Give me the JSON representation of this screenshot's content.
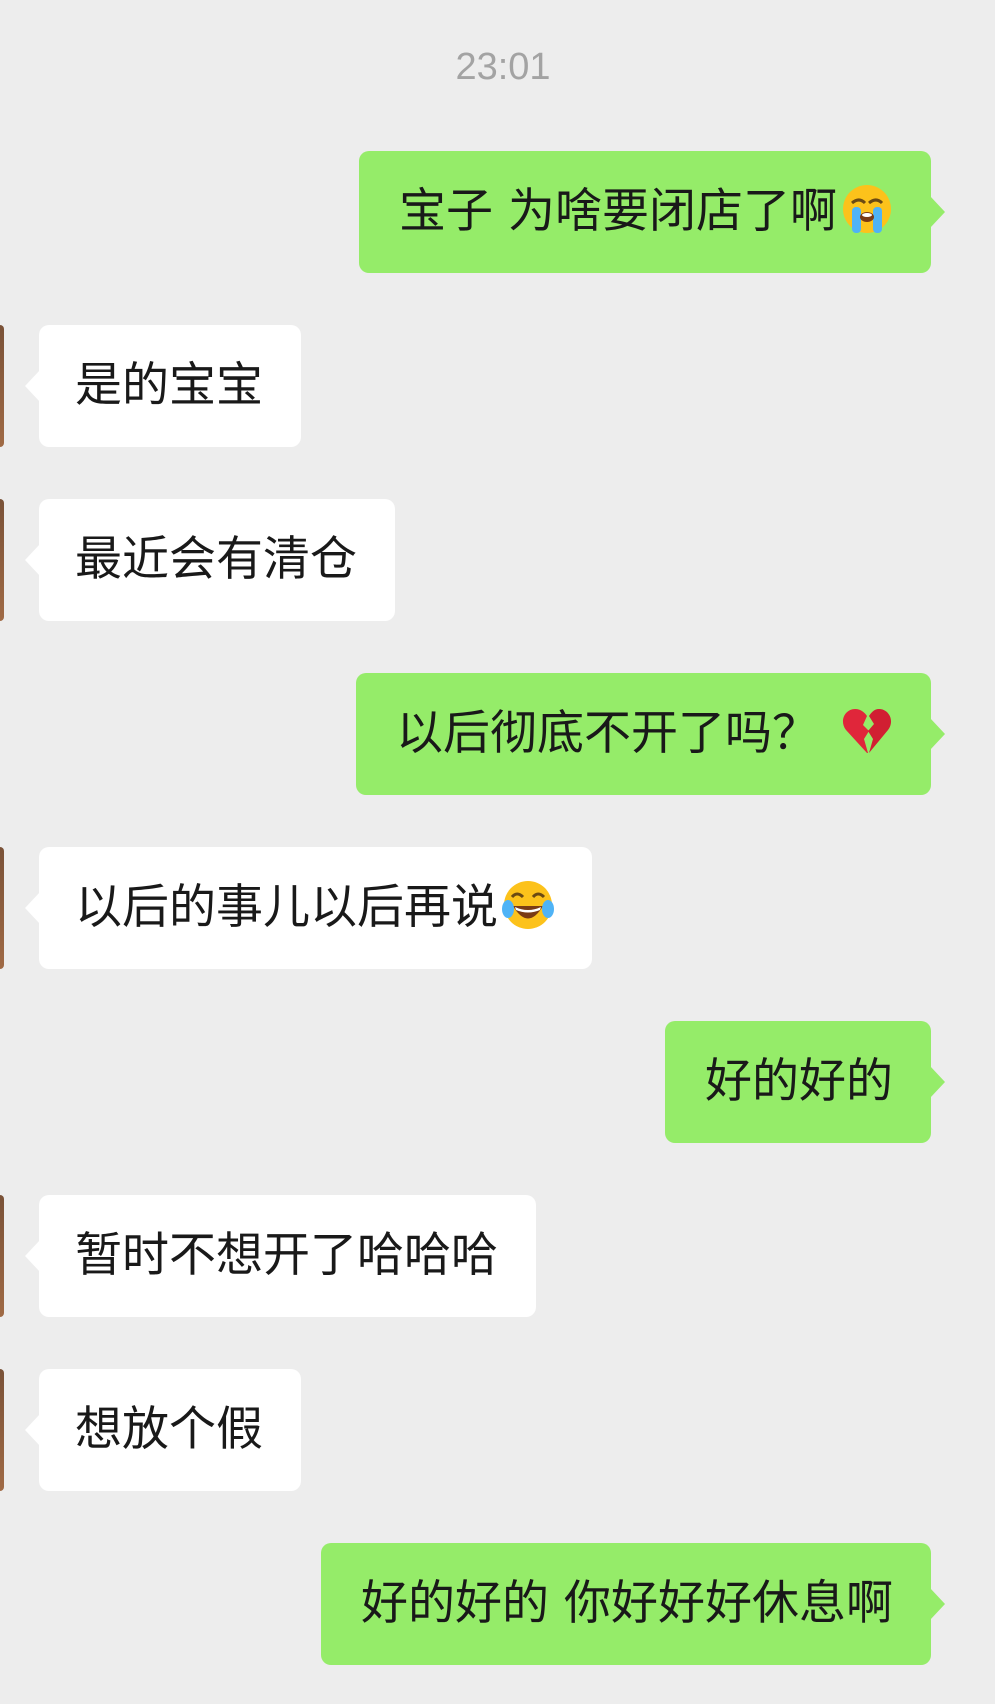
{
  "chat": {
    "timestamp": "23:01",
    "messages": [
      {
        "sender": "me",
        "text": "宝子 为啥要闭店了啊",
        "emoji": "loudly-crying-face-emoji"
      },
      {
        "sender": "them",
        "text": "是的宝宝"
      },
      {
        "sender": "them",
        "text": "最近会有清仓"
      },
      {
        "sender": "me",
        "text": "以后彻底不开了吗？",
        "emoji": "broken-heart-emoji"
      },
      {
        "sender": "them",
        "text": "以后的事儿以后再说",
        "emoji": "face-with-tears-of-joy-emoji"
      },
      {
        "sender": "me",
        "text": "好的好的"
      },
      {
        "sender": "them",
        "text": "暂时不想开了哈哈哈"
      },
      {
        "sender": "them",
        "text": "想放个假"
      },
      {
        "sender": "me",
        "text": "好的好的 你好好好休息啊"
      }
    ]
  },
  "colors": {
    "background": "#ededed",
    "sent_bubble": "#95ec69",
    "received_bubble": "#ffffff",
    "timestamp_text": "#a3a3a3"
  }
}
